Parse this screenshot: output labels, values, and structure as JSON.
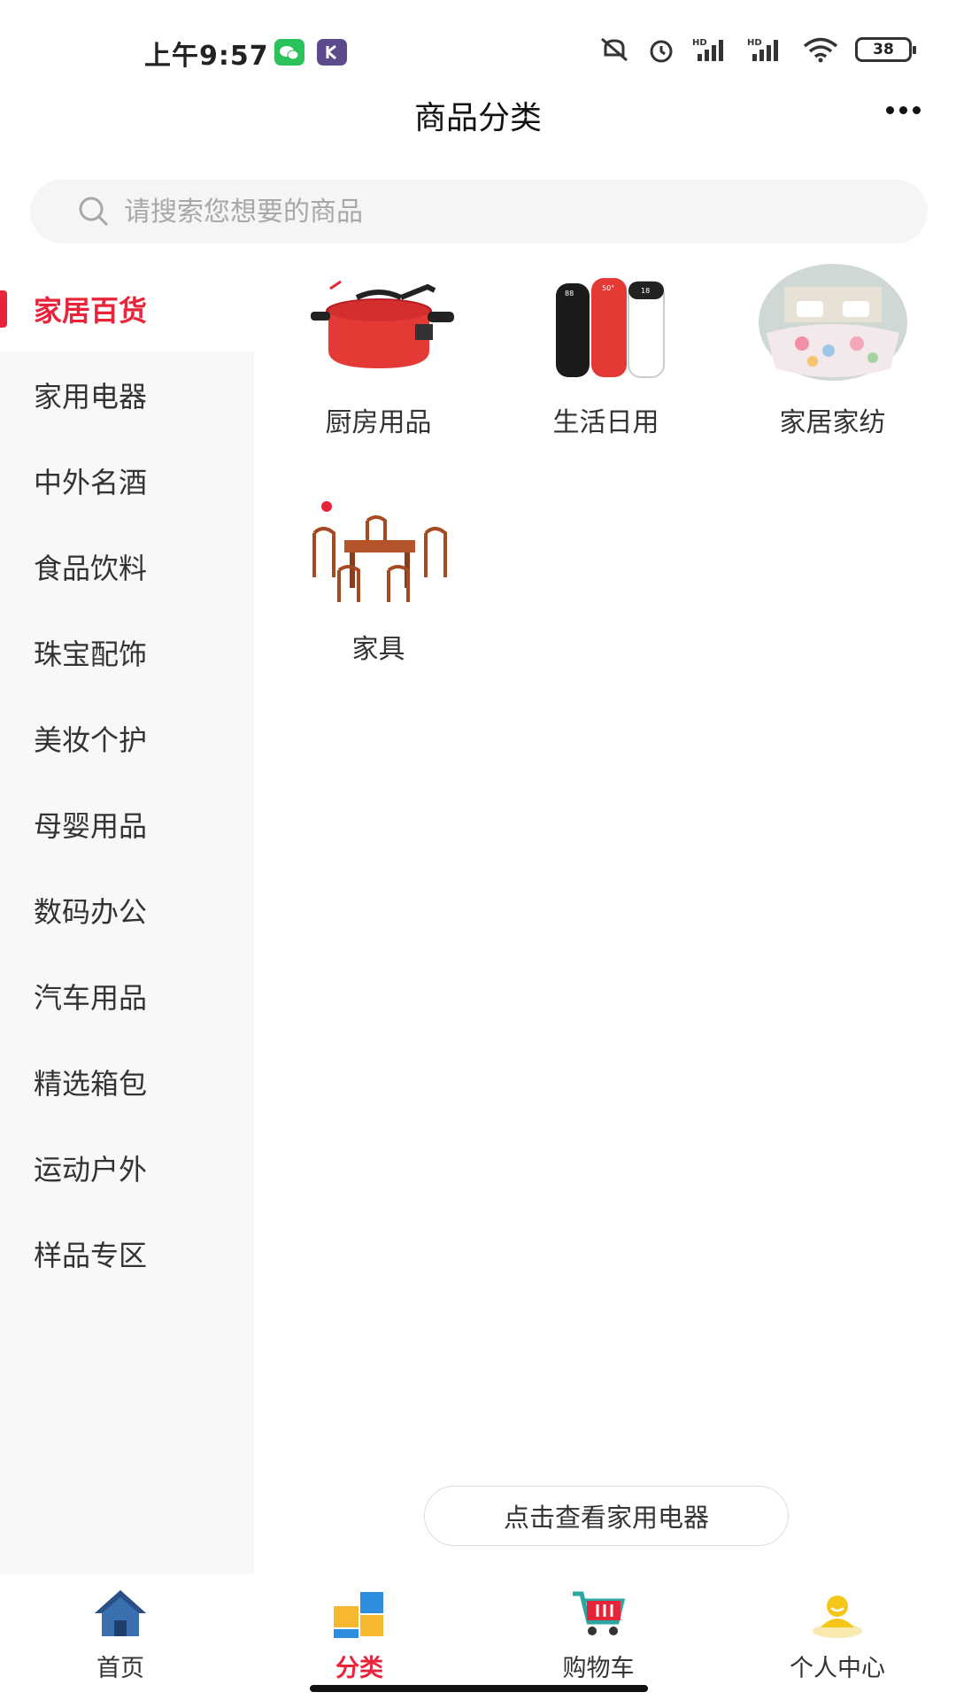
{
  "status": {
    "time": "上午9:57",
    "battery": "38"
  },
  "header": {
    "title": "商品分类"
  },
  "search": {
    "placeholder": "请搜索您想要的商品"
  },
  "sidebar": {
    "items": [
      {
        "label": "家居百货",
        "active": true
      },
      {
        "label": "家用电器"
      },
      {
        "label": "中外名酒"
      },
      {
        "label": "食品饮料"
      },
      {
        "label": "珠宝配饰"
      },
      {
        "label": "美妆个护"
      },
      {
        "label": "母婴用品"
      },
      {
        "label": "数码办公"
      },
      {
        "label": "汽车用品"
      },
      {
        "label": "精选箱包"
      },
      {
        "label": "运动户外"
      },
      {
        "label": "样品专区"
      }
    ]
  },
  "categories": [
    {
      "label": "厨房用品",
      "icon": "pot-image"
    },
    {
      "label": "生活日用",
      "icon": "thermos-image"
    },
    {
      "label": "家居家纺",
      "icon": "bedding-image"
    },
    {
      "label": "家具",
      "icon": "furniture-image"
    }
  ],
  "view_more": {
    "label": "点击查看家用电器"
  },
  "tabbar": {
    "tabs": [
      {
        "label": "首页",
        "icon": "home-icon"
      },
      {
        "label": "分类",
        "icon": "category-icon",
        "active": true
      },
      {
        "label": "购物车",
        "icon": "cart-icon"
      },
      {
        "label": "个人中心",
        "icon": "user-icon"
      }
    ]
  },
  "colors": {
    "accent": "#e8243a",
    "sidebar_bg": "#f7f8fa"
  }
}
